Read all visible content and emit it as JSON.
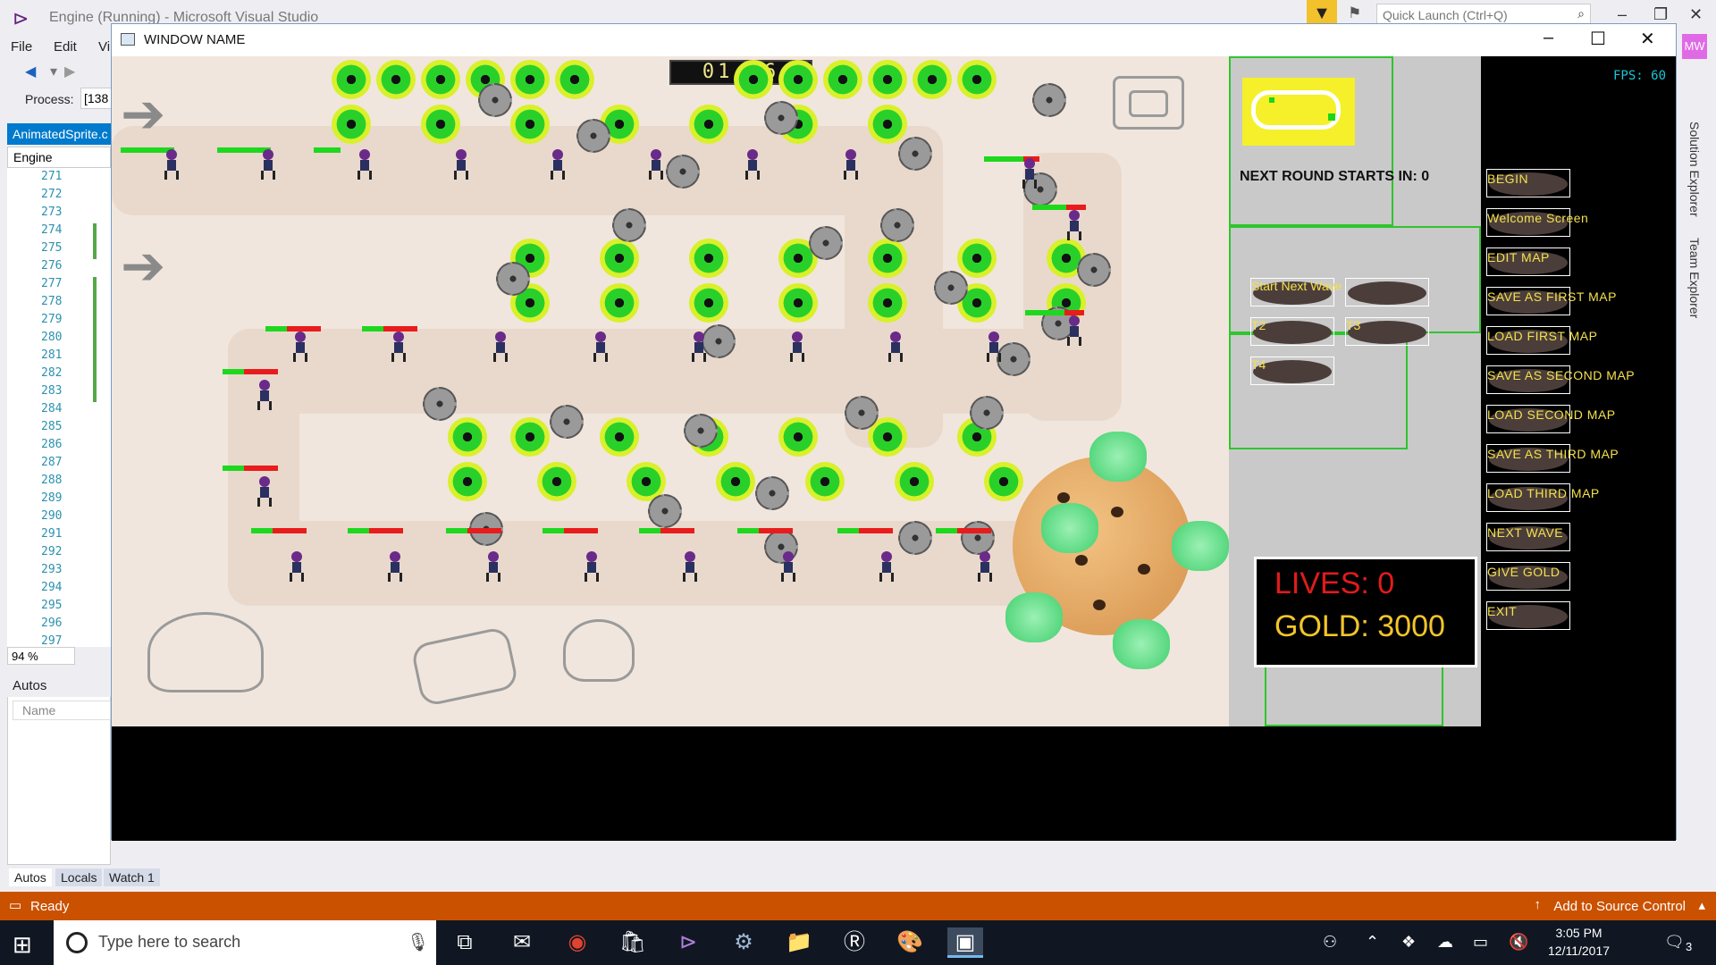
{
  "vs": {
    "title": "Engine (Running) - Microsoft Visual Studio",
    "quick_launch": "Quick Launch (Ctrl+Q)",
    "user_initials": "MW",
    "menu": [
      "File",
      "Edit",
      "Vi"
    ],
    "process_label": "Process:",
    "process_value": "[138",
    "doc_tab": "AnimatedSprite.c",
    "nav": "Engine",
    "line_numbers": [
      "271",
      "272",
      "273",
      "274",
      "275",
      "276",
      "277",
      "278",
      "279",
      "280",
      "281",
      "282",
      "283",
      "284",
      "285",
      "286",
      "287",
      "288",
      "289",
      "290",
      "291",
      "292",
      "293",
      "294",
      "295",
      "296",
      "297"
    ],
    "zoom": "94 %",
    "autos_title": "Autos",
    "autos_col": "Name",
    "bottom_tabs": [
      "Autos",
      "Locals",
      "Watch 1"
    ],
    "status_ready": "Ready",
    "status_source": "Add to Source Control",
    "right_rail": [
      "Solution Explorer",
      "Team Explorer"
    ]
  },
  "taskbar": {
    "search_placeholder": "Type here to search",
    "time": "3:05 PM",
    "date": "12/11/2017",
    "notifications": "3"
  },
  "game": {
    "window_title": "WINDOW NAME",
    "fps": "FPS: 60",
    "timer": "01:06",
    "next_round": "NEXT ROUND STARTS IN: 0",
    "lives": "LIVES: 0",
    "gold": "GOLD: 3000",
    "panel_buttons": [
      "Start Next Wave",
      "T2",
      "T3",
      "T4"
    ],
    "menu_buttons": [
      "BEGIN",
      "Welcome Screen",
      "EDIT MAP",
      "SAVE AS FIRST MAP",
      "LOAD FIRST MAP",
      "SAVE AS SECOND MAP",
      "LOAD SECOND MAP",
      "SAVE AS THIRD MAP",
      "LOAD THIRD MAP",
      "NEXT WAVE",
      "GIVE GOLD",
      "EXIT"
    ]
  },
  "colors": {
    "accent": "#007acc",
    "status_bar": "#ca5100",
    "lives": "#e21b1b",
    "gold": "#f3c52a",
    "button_label": "#f4e04d"
  }
}
